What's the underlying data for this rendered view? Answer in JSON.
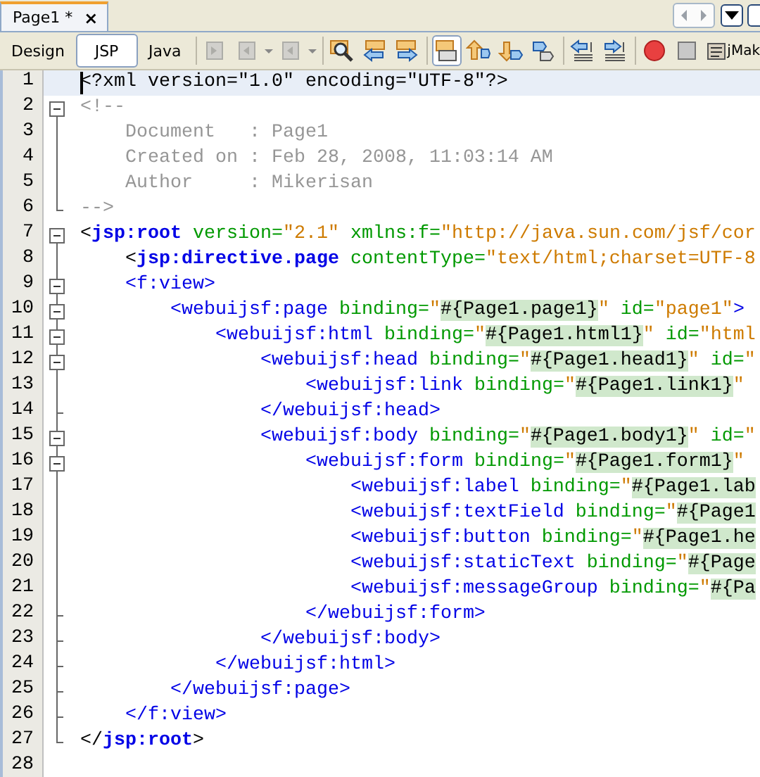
{
  "tab": {
    "title": "Page1 *",
    "close": "×"
  },
  "views": [
    {
      "label": "Design",
      "selected": false
    },
    {
      "label": "JSP",
      "selected": true
    },
    {
      "label": "Java",
      "selected": false
    }
  ],
  "toolbar_buttons": [
    {
      "kind": "back",
      "disabled": true,
      "pressed": false
    },
    {
      "kind": "doc-menu",
      "disabled": true,
      "pressed": false
    },
    {
      "kind": "doc-menu2",
      "disabled": true,
      "pressed": false
    },
    {
      "kind": "find",
      "disabled": false,
      "pressed": false
    },
    {
      "kind": "find-prev",
      "disabled": false,
      "pressed": false
    },
    {
      "kind": "find-next",
      "disabled": false,
      "pressed": false
    },
    {
      "kind": "highlight",
      "disabled": false,
      "pressed": true
    },
    {
      "kind": "up",
      "disabled": false,
      "pressed": false
    },
    {
      "kind": "down",
      "disabled": false,
      "pressed": false
    },
    {
      "kind": "toggle",
      "disabled": false,
      "pressed": false
    },
    {
      "kind": "shift-left",
      "disabled": false,
      "pressed": false
    },
    {
      "kind": "shift-right",
      "disabled": false,
      "pressed": false
    },
    {
      "kind": "record",
      "disabled": false,
      "pressed": false
    },
    {
      "kind": "stop",
      "disabled": false,
      "pressed": false
    }
  ],
  "palette_label": "jMak",
  "lines": [
    {
      "number": "1",
      "fold_toggle": false,
      "guide": false,
      "fold_end": false,
      "current": true,
      "tokens": [
        {
          "kind": "plain",
          "text": "<?xml version=\"1.0\" encoding=\"UTF-8\"?>"
        }
      ]
    },
    {
      "number": "2",
      "fold_toggle": true,
      "guide": true,
      "fold_end": false,
      "current": false,
      "tokens": [
        {
          "kind": "comment",
          "text": "<!--"
        }
      ]
    },
    {
      "number": "3",
      "fold_toggle": false,
      "guide": true,
      "fold_end": false,
      "current": false,
      "tokens": [
        {
          "kind": "comment",
          "text": "    Document   : Page1"
        }
      ]
    },
    {
      "number": "4",
      "fold_toggle": false,
      "guide": true,
      "fold_end": false,
      "current": false,
      "tokens": [
        {
          "kind": "comment",
          "text": "    Created on : Feb 28, 2008, 11:03:14 AM"
        }
      ]
    },
    {
      "number": "5",
      "fold_toggle": false,
      "guide": true,
      "fold_end": false,
      "current": false,
      "tokens": [
        {
          "kind": "comment",
          "text": "    Author     : Mikerisan"
        }
      ]
    },
    {
      "number": "6",
      "fold_toggle": false,
      "guide": false,
      "fold_end": true,
      "current": false,
      "tokens": [
        {
          "kind": "comment",
          "text": "-->"
        }
      ]
    },
    {
      "number": "7",
      "fold_toggle": true,
      "guide": true,
      "fold_end": false,
      "current": false,
      "tokens": [
        {
          "kind": "plain",
          "text": "<"
        },
        {
          "kind": "strong-tag",
          "text": "jsp:root"
        },
        {
          "kind": "attr",
          "text": " version="
        },
        {
          "kind": "string",
          "text": "\"2.1\""
        },
        {
          "kind": "attr",
          "text": " xmlns:f="
        },
        {
          "kind": "string",
          "text": "\"http://java.sun.com/jsf/cor"
        }
      ]
    },
    {
      "number": "8",
      "fold_toggle": false,
      "guide": true,
      "fold_end": false,
      "current": false,
      "tokens": [
        {
          "kind": "plain",
          "text": "    <"
        },
        {
          "kind": "strong-tag",
          "text": "jsp:directive.page"
        },
        {
          "kind": "attr",
          "text": " contentType="
        },
        {
          "kind": "string",
          "text": "\"text/html;charset=UTF-8"
        }
      ]
    },
    {
      "number": "9",
      "fold_toggle": true,
      "guide": true,
      "fold_end": false,
      "current": false,
      "tokens": [
        {
          "kind": "tag",
          "text": "    <f:view>"
        }
      ]
    },
    {
      "number": "10",
      "fold_toggle": true,
      "guide": true,
      "fold_end": false,
      "current": false,
      "tokens": [
        {
          "kind": "tag",
          "text": "        <webuijsf:page"
        },
        {
          "kind": "attr",
          "text": " binding="
        },
        {
          "kind": "string",
          "text": "\""
        },
        {
          "kind": "expression",
          "text": "#{Page1.page1}"
        },
        {
          "kind": "string",
          "text": "\""
        },
        {
          "kind": "attr",
          "text": " id="
        },
        {
          "kind": "string",
          "text": "\"page1\""
        },
        {
          "kind": "tag",
          "text": ">"
        }
      ]
    },
    {
      "number": "11",
      "fold_toggle": true,
      "guide": true,
      "fold_end": false,
      "current": false,
      "tokens": [
        {
          "kind": "tag",
          "text": "            <webuijsf:html"
        },
        {
          "kind": "attr",
          "text": " binding="
        },
        {
          "kind": "string",
          "text": "\""
        },
        {
          "kind": "expression",
          "text": "#{Page1.html1}"
        },
        {
          "kind": "string",
          "text": "\""
        },
        {
          "kind": "attr",
          "text": " id="
        },
        {
          "kind": "string",
          "text": "\"html"
        }
      ]
    },
    {
      "number": "12",
      "fold_toggle": true,
      "guide": true,
      "fold_end": false,
      "current": false,
      "tokens": [
        {
          "kind": "tag",
          "text": "                <webuijsf:head"
        },
        {
          "kind": "attr",
          "text": " binding="
        },
        {
          "kind": "string",
          "text": "\""
        },
        {
          "kind": "expression",
          "text": "#{Page1.head1}"
        },
        {
          "kind": "string",
          "text": "\""
        },
        {
          "kind": "attr",
          "text": " id="
        },
        {
          "kind": "string",
          "text": "\""
        }
      ]
    },
    {
      "number": "13",
      "fold_toggle": false,
      "guide": true,
      "fold_end": false,
      "current": false,
      "tokens": [
        {
          "kind": "tag",
          "text": "                    <webuijsf:link"
        },
        {
          "kind": "attr",
          "text": " binding="
        },
        {
          "kind": "string",
          "text": "\""
        },
        {
          "kind": "expression",
          "text": "#{Page1.link1}"
        },
        {
          "kind": "string",
          "text": "\""
        }
      ]
    },
    {
      "number": "14",
      "fold_toggle": false,
      "guide": true,
      "fold_end": true,
      "current": false,
      "tokens": [
        {
          "kind": "tag",
          "text": "                </webuijsf:head>"
        }
      ]
    },
    {
      "number": "15",
      "fold_toggle": true,
      "guide": true,
      "fold_end": false,
      "current": false,
      "tokens": [
        {
          "kind": "tag",
          "text": "                <webuijsf:body"
        },
        {
          "kind": "attr",
          "text": " binding="
        },
        {
          "kind": "string",
          "text": "\""
        },
        {
          "kind": "expression",
          "text": "#{Page1.body1}"
        },
        {
          "kind": "string",
          "text": "\""
        },
        {
          "kind": "attr",
          "text": " id="
        },
        {
          "kind": "string",
          "text": "\""
        }
      ]
    },
    {
      "number": "16",
      "fold_toggle": true,
      "guide": true,
      "fold_end": false,
      "current": false,
      "tokens": [
        {
          "kind": "tag",
          "text": "                    <webuijsf:form"
        },
        {
          "kind": "attr",
          "text": " binding="
        },
        {
          "kind": "string",
          "text": "\""
        },
        {
          "kind": "expression",
          "text": "#{Page1.form1}"
        },
        {
          "kind": "string",
          "text": "\""
        }
      ]
    },
    {
      "number": "17",
      "fold_toggle": false,
      "guide": true,
      "fold_end": false,
      "current": false,
      "tokens": [
        {
          "kind": "tag",
          "text": "                        <webuijsf:label"
        },
        {
          "kind": "attr",
          "text": " binding="
        },
        {
          "kind": "string",
          "text": "\""
        },
        {
          "kind": "expression",
          "text": "#{Page1.lab"
        }
      ]
    },
    {
      "number": "18",
      "fold_toggle": false,
      "guide": true,
      "fold_end": false,
      "current": false,
      "tokens": [
        {
          "kind": "tag",
          "text": "                        <webuijsf:textField"
        },
        {
          "kind": "attr",
          "text": " binding="
        },
        {
          "kind": "string",
          "text": "\""
        },
        {
          "kind": "expression",
          "text": "#{Page1"
        }
      ]
    },
    {
      "number": "19",
      "fold_toggle": false,
      "guide": true,
      "fold_end": false,
      "current": false,
      "tokens": [
        {
          "kind": "tag",
          "text": "                        <webuijsf:button"
        },
        {
          "kind": "attr",
          "text": " binding="
        },
        {
          "kind": "string",
          "text": "\""
        },
        {
          "kind": "expression",
          "text": "#{Page1.he"
        }
      ]
    },
    {
      "number": "20",
      "fold_toggle": false,
      "guide": true,
      "fold_end": false,
      "current": false,
      "tokens": [
        {
          "kind": "tag",
          "text": "                        <webuijsf:staticText"
        },
        {
          "kind": "attr",
          "text": " binding="
        },
        {
          "kind": "string",
          "text": "\""
        },
        {
          "kind": "expression",
          "text": "#{Page"
        }
      ]
    },
    {
      "number": "21",
      "fold_toggle": false,
      "guide": true,
      "fold_end": false,
      "current": false,
      "tokens": [
        {
          "kind": "tag",
          "text": "                        <webuijsf:messageGroup"
        },
        {
          "kind": "attr",
          "text": " binding="
        },
        {
          "kind": "string",
          "text": "\""
        },
        {
          "kind": "expression",
          "text": "#{Pa"
        }
      ]
    },
    {
      "number": "22",
      "fold_toggle": false,
      "guide": true,
      "fold_end": true,
      "current": false,
      "tokens": [
        {
          "kind": "tag",
          "text": "                    </webuijsf:form>"
        }
      ]
    },
    {
      "number": "23",
      "fold_toggle": false,
      "guide": true,
      "fold_end": true,
      "current": false,
      "tokens": [
        {
          "kind": "tag",
          "text": "                </webuijsf:body>"
        }
      ]
    },
    {
      "number": "24",
      "fold_toggle": false,
      "guide": true,
      "fold_end": true,
      "current": false,
      "tokens": [
        {
          "kind": "tag",
          "text": "            </webuijsf:html>"
        }
      ]
    },
    {
      "number": "25",
      "fold_toggle": false,
      "guide": true,
      "fold_end": true,
      "current": false,
      "tokens": [
        {
          "kind": "tag",
          "text": "        </webuijsf:page>"
        }
      ]
    },
    {
      "number": "26",
      "fold_toggle": false,
      "guide": true,
      "fold_end": true,
      "current": false,
      "tokens": [
        {
          "kind": "tag",
          "text": "    </f:view>"
        }
      ]
    },
    {
      "number": "27",
      "fold_toggle": false,
      "guide": false,
      "fold_end": true,
      "current": false,
      "tokens": [
        {
          "kind": "plain",
          "text": "</"
        },
        {
          "kind": "strong-tag",
          "text": "jsp:root"
        },
        {
          "kind": "plain",
          "text": ">"
        }
      ]
    },
    {
      "number": "28",
      "fold_toggle": false,
      "guide": false,
      "fold_end": false,
      "current": false
    }
  ]
}
